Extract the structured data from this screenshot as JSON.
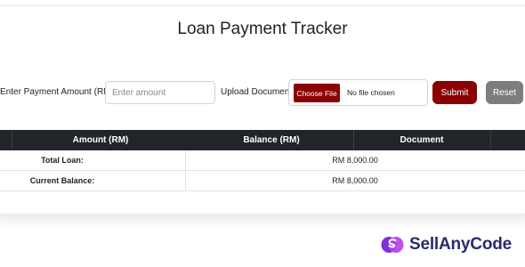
{
  "page": {
    "title": "Loan Payment Tracker"
  },
  "form": {
    "amount_label": "Enter Payment Amount (RM):",
    "amount_placeholder": "Enter amount",
    "document_label": "Upload Document:",
    "choose_file_label": "Choose File",
    "file_status": "No file chosen",
    "submit_label": "Submit",
    "reset_label": "Reset"
  },
  "table": {
    "headers": [
      "Amount (RM)",
      "Balance (RM)",
      "Document"
    ],
    "rows": [
      {
        "label": "Total Loan:",
        "value": "RM 8,000.00"
      },
      {
        "label": "Current Balance:",
        "value": "RM 8,000.00"
      }
    ]
  },
  "brand": {
    "name": "SellAnyCode",
    "color": "#6c2bd9"
  },
  "colors": {
    "primary": "#8b0000",
    "secondary": "#7d7d7d",
    "table_header": "#212529"
  }
}
